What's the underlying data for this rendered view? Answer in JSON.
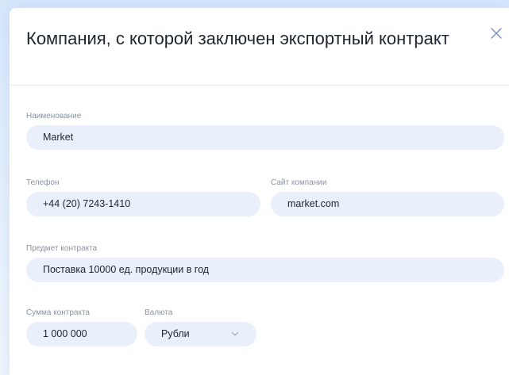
{
  "modal": {
    "title": "Компания, с которой заключен экспортный контракт",
    "close_icon": "close-icon"
  },
  "form": {
    "name": {
      "label": "Наименование",
      "value": "Market"
    },
    "phone": {
      "label": "Телефон",
      "value": "+44 (20) 7243-1410"
    },
    "website": {
      "label": "Сайт компании",
      "value": "market.com"
    },
    "subject": {
      "label": "Предмет контракта",
      "value": "Поставка 10000 ед. продукции в год"
    },
    "amount": {
      "label": "Сумма контракта",
      "value": "1 000 000"
    },
    "currency": {
      "label": "Валюта",
      "value": "Рубли",
      "icon": "chevron-down-icon"
    }
  },
  "colors": {
    "field_bg": "#eaf0fb",
    "label": "#8a93a2",
    "text": "#1f2530",
    "close": "#7a8cc8",
    "page_bg": "#d5e6fb"
  }
}
